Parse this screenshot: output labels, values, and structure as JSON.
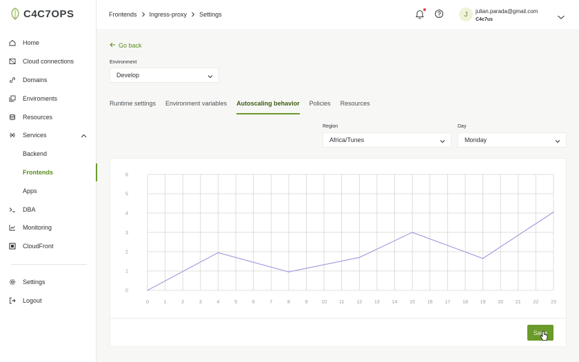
{
  "brand": {
    "name": "C4C7OPS"
  },
  "sidebar": {
    "items": [
      {
        "label": "Home",
        "icon": "home-icon"
      },
      {
        "label": "Cloud connections",
        "icon": "cloud-icon"
      },
      {
        "label": "Domains",
        "icon": "link-icon"
      },
      {
        "label": "Enviroments",
        "icon": "layers-icon"
      },
      {
        "label": "Resources",
        "icon": "database-icon"
      },
      {
        "label": "Services",
        "icon": "services-icon"
      }
    ],
    "sub_items": [
      {
        "label": "Backend"
      },
      {
        "label": "Frontends"
      },
      {
        "label": "Apps"
      }
    ],
    "items2": [
      {
        "label": "DBA",
        "icon": "terminal-icon"
      },
      {
        "label": "Monitoring",
        "icon": "chart-icon"
      },
      {
        "label": "CloudFront",
        "icon": "cloudfront-icon"
      }
    ],
    "bottom": [
      {
        "label": "Settings",
        "icon": "gear-icon"
      },
      {
        "label": "Logout",
        "icon": "logout-icon"
      }
    ]
  },
  "header": {
    "breadcrumb": [
      "Frontends",
      "Ingress-proxy",
      "Settings"
    ],
    "user_initial": "J",
    "user_email": "julian.parada@gmail.com",
    "user_org": "C4c7us"
  },
  "main": {
    "go_back": "Go back",
    "environment_label": "Environment",
    "environment_value": "Develop",
    "tabs": [
      "Runtime settings",
      "Environment variables",
      "Autoscaling behavior",
      "Policies",
      "Resources"
    ],
    "region_label": "Region",
    "region_value": "Africa/Tunes",
    "day_label": "Day",
    "day_value": "Monday",
    "save_label": "Save"
  },
  "colors": {
    "accent": "#6a9a2a",
    "line": "#a89be0",
    "grid": "#d4d6d2"
  },
  "chart_data": {
    "type": "line",
    "x": [
      0,
      4,
      8,
      12,
      15,
      19,
      23
    ],
    "y": [
      0,
      1.95,
      0.95,
      1.7,
      3,
      1.65,
      4.05
    ],
    "xticks": [
      "0",
      "1",
      "2",
      "3",
      "4",
      "5",
      "6",
      "7",
      "8",
      "9",
      "10",
      "11",
      "12",
      "13",
      "14",
      "15",
      "16",
      "17",
      "18",
      "19",
      "20",
      "21",
      "22",
      "23"
    ],
    "yticks": [
      "0",
      "1",
      "2",
      "3",
      "4",
      "5",
      "6"
    ],
    "xlim": [
      0,
      23
    ],
    "ylim": [
      0,
      6
    ],
    "grid": true
  }
}
